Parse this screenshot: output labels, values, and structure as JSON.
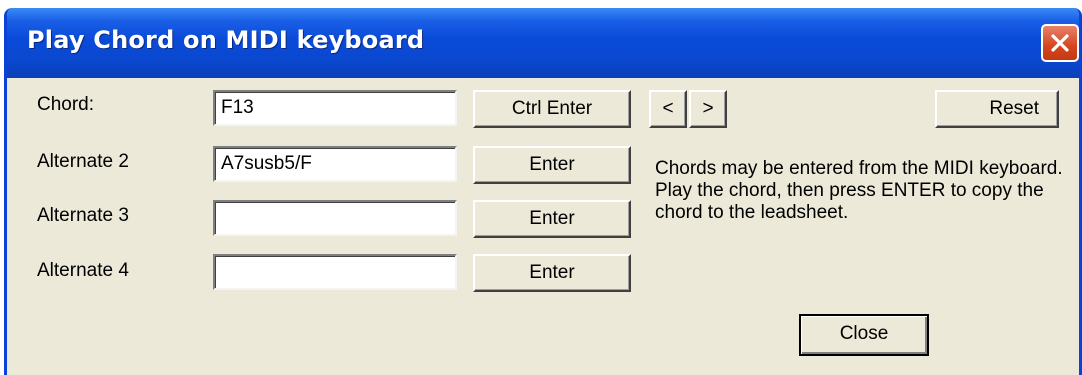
{
  "window": {
    "title": "Play Chord on MIDI keyboard"
  },
  "rows": [
    {
      "label": "Chord:",
      "value": "F13",
      "button": "Ctrl Enter"
    },
    {
      "label": "Alternate 2",
      "value": "A7susb5/F",
      "button": "Enter"
    },
    {
      "label": "Alternate 3",
      "value": "",
      "button": "Enter"
    },
    {
      "label": "Alternate 4",
      "value": "",
      "button": "Enter"
    }
  ],
  "nav": {
    "prev": "<",
    "next": ">"
  },
  "reset_label": "Reset",
  "note": "Chords may be entered from the MIDI keyboard. Play the chord, then press ENTER to copy the chord to the leadsheet.",
  "close_label": "Close",
  "icons": {
    "close": "close-icon"
  },
  "colors": {
    "titlebar": "#0a48d0",
    "close_button": "#d4451e",
    "dialog_bg": "#ece9d8"
  }
}
